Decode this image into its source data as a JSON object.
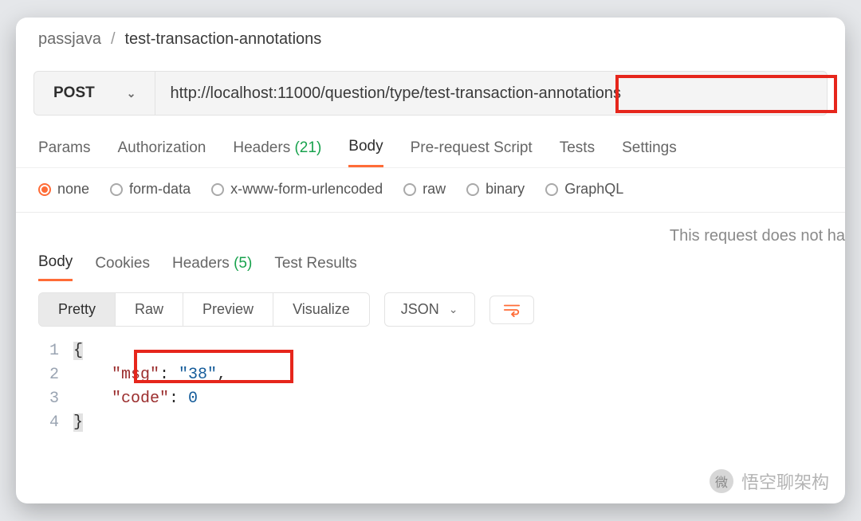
{
  "breadcrumb": {
    "workspace": "passjava",
    "separator": "/",
    "current": "test-transaction-annotations"
  },
  "request": {
    "method": "POST",
    "url": "http://localhost:11000/question/type/test-transaction-annotations"
  },
  "req_tabs": {
    "items": [
      {
        "label": "Params"
      },
      {
        "label": "Authorization"
      },
      {
        "label": "Headers",
        "count": "(21)"
      },
      {
        "label": "Body",
        "active": true
      },
      {
        "label": "Pre-request Script"
      },
      {
        "label": "Tests"
      },
      {
        "label": "Settings"
      }
    ]
  },
  "body_types": {
    "items": [
      {
        "label": "none",
        "selected": true
      },
      {
        "label": "form-data"
      },
      {
        "label": "x-www-form-urlencoded"
      },
      {
        "label": "raw"
      },
      {
        "label": "binary"
      },
      {
        "label": "GraphQL"
      }
    ]
  },
  "nobody_message": "This request does not ha",
  "resp_tabs": {
    "items": [
      {
        "label": "Body",
        "active": true
      },
      {
        "label": "Cookies"
      },
      {
        "label": "Headers",
        "count": "(5)"
      },
      {
        "label": "Test Results"
      }
    ]
  },
  "view_modes": {
    "items": [
      {
        "label": "Pretty",
        "active": true
      },
      {
        "label": "Raw"
      },
      {
        "label": "Preview"
      },
      {
        "label": "Visualize"
      }
    ],
    "format": "JSON"
  },
  "response_body": {
    "lines": [
      "1",
      "2",
      "3",
      "4"
    ],
    "open_brace": "{",
    "close_brace": "}",
    "msg_key": "\"msg\"",
    "msg_val": "\"38\"",
    "code_key": "\"code\"",
    "code_val": "0",
    "colon": ": ",
    "comma": ","
  },
  "watermark": {
    "icon_label": "微",
    "text": "悟空聊架构"
  }
}
